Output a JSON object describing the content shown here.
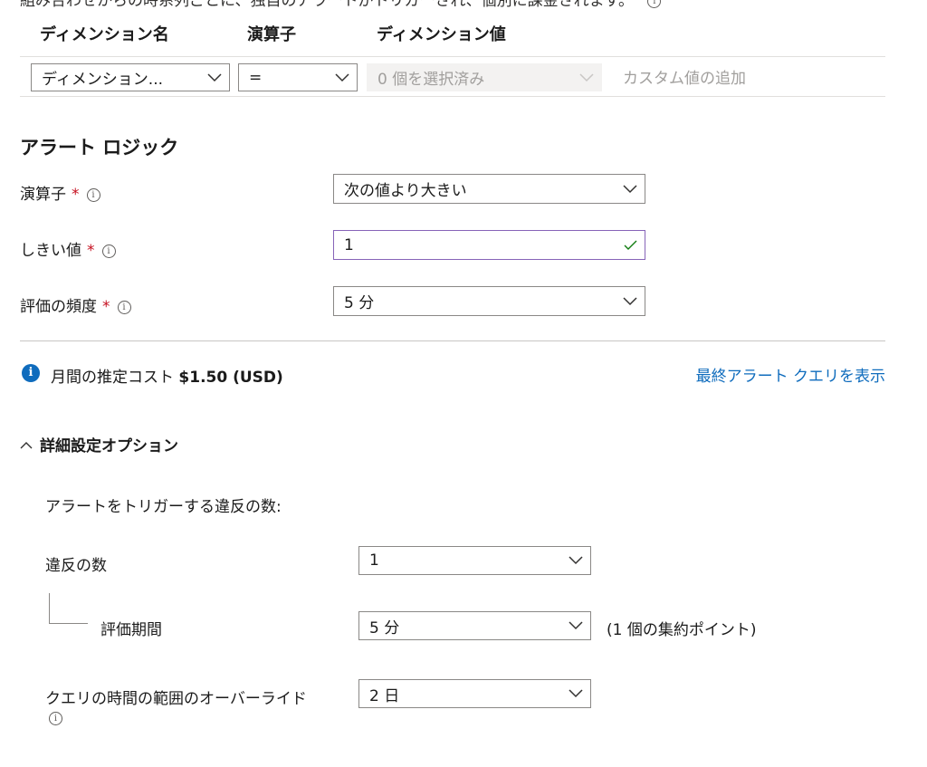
{
  "top_text": "組み合わせからの時系列ごとに、独自のアラートがトリガーされ、個別に課金されます。",
  "dimensions": {
    "headers": [
      "ディメンション名",
      "演算子",
      "ディメンション値"
    ],
    "row": {
      "name_value": "ディメンション...",
      "operator_value": "=",
      "values_value": "0 個を選択済み",
      "custom_placeholder": "カスタム値の追加"
    }
  },
  "alert_logic": {
    "title": "アラート ロジック",
    "operator_label": "演算子",
    "operator_value": "次の値より大きい",
    "threshold_label": "しきい値",
    "threshold_value": "1",
    "frequency_label": "評価の頻度",
    "frequency_value": "5 分",
    "required_mark": "*"
  },
  "cost": {
    "prefix": "月間の推定コスト",
    "amount": "$1.50 (USD)",
    "view_query_link": "最終アラート クエリを表示"
  },
  "advanced": {
    "toggle_label": "詳細設定オプション",
    "violations_header": "アラートをトリガーする違反の数:",
    "violations_label": "違反の数",
    "violations_value": "1",
    "period_label": "評価期間",
    "period_value": "5 分",
    "period_note": "(1 個の集約ポイント)",
    "override_label": "クエリの時間の範囲のオーバーライド",
    "override_value": "2 日"
  },
  "colors": {
    "accent": "#0f6cbd",
    "required": "#c50f1f",
    "focus_border": "#8764b8",
    "valid_check": "#107c10"
  }
}
